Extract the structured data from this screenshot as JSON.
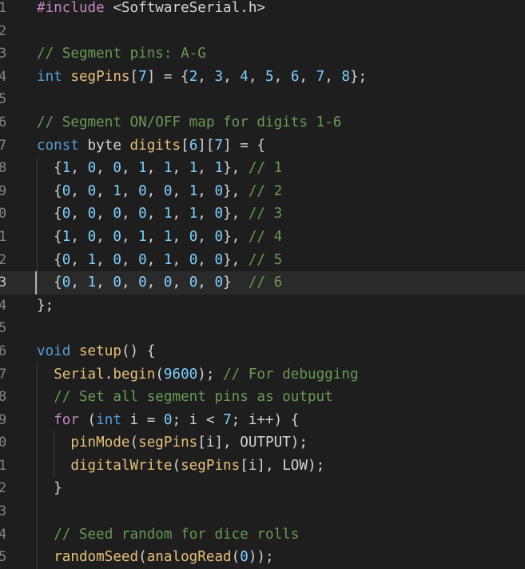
{
  "editor": {
    "language": "Arduino C++",
    "lines": [
      {
        "n": "1",
        "segs": [
          {
            "t": "#include ",
            "c": "c-pre"
          },
          {
            "t": "<SoftwareSerial.h>",
            "c": "c-str"
          }
        ]
      },
      {
        "n": "2",
        "segs": []
      },
      {
        "n": "3",
        "segs": [
          {
            "t": "// Segment pins: A-G",
            "c": "c-comment"
          }
        ]
      },
      {
        "n": "4",
        "segs": [
          {
            "t": "int",
            "c": "c-kw"
          },
          {
            "t": " ",
            "c": "c-id"
          },
          {
            "t": "segPins",
            "c": "c-var"
          },
          {
            "t": "[",
            "c": "c-id"
          },
          {
            "t": "7",
            "c": "c-num"
          },
          {
            "t": "] = {",
            "c": "c-id"
          },
          {
            "t": "2",
            "c": "c-num"
          },
          {
            "t": ", ",
            "c": "c-id"
          },
          {
            "t": "3",
            "c": "c-num"
          },
          {
            "t": ", ",
            "c": "c-id"
          },
          {
            "t": "4",
            "c": "c-num"
          },
          {
            "t": ", ",
            "c": "c-id"
          },
          {
            "t": "5",
            "c": "c-num"
          },
          {
            "t": ", ",
            "c": "c-id"
          },
          {
            "t": "6",
            "c": "c-num"
          },
          {
            "t": ", ",
            "c": "c-id"
          },
          {
            "t": "7",
            "c": "c-num"
          },
          {
            "t": ", ",
            "c": "c-id"
          },
          {
            "t": "8",
            "c": "c-num"
          },
          {
            "t": "};",
            "c": "c-id"
          }
        ]
      },
      {
        "n": "5",
        "segs": []
      },
      {
        "n": "6",
        "segs": [
          {
            "t": "// Segment ON/OFF map for digits 1-6",
            "c": "c-comment"
          }
        ]
      },
      {
        "n": "7",
        "segs": [
          {
            "t": "const",
            "c": "c-kw"
          },
          {
            "t": " byte ",
            "c": "c-id"
          },
          {
            "t": "digits",
            "c": "c-var"
          },
          {
            "t": "[",
            "c": "c-id"
          },
          {
            "t": "6",
            "c": "c-num"
          },
          {
            "t": "][",
            "c": "c-id"
          },
          {
            "t": "7",
            "c": "c-num"
          },
          {
            "t": "] = {",
            "c": "c-id"
          }
        ]
      },
      {
        "n": "8",
        "indent": 1,
        "segs": [
          {
            "t": "  {",
            "c": "c-id"
          },
          {
            "t": "1",
            "c": "c-num"
          },
          {
            "t": ", ",
            "c": "c-id"
          },
          {
            "t": "0",
            "c": "c-num"
          },
          {
            "t": ", ",
            "c": "c-id"
          },
          {
            "t": "0",
            "c": "c-num"
          },
          {
            "t": ", ",
            "c": "c-id"
          },
          {
            "t": "1",
            "c": "c-num"
          },
          {
            "t": ", ",
            "c": "c-id"
          },
          {
            "t": "1",
            "c": "c-num"
          },
          {
            "t": ", ",
            "c": "c-id"
          },
          {
            "t": "1",
            "c": "c-num"
          },
          {
            "t": ", ",
            "c": "c-id"
          },
          {
            "t": "1",
            "c": "c-num"
          },
          {
            "t": "}, ",
            "c": "c-id"
          },
          {
            "t": "// 1",
            "c": "c-comment"
          }
        ]
      },
      {
        "n": "9",
        "indent": 1,
        "segs": [
          {
            "t": "  {",
            "c": "c-id"
          },
          {
            "t": "0",
            "c": "c-num"
          },
          {
            "t": ", ",
            "c": "c-id"
          },
          {
            "t": "0",
            "c": "c-num"
          },
          {
            "t": ", ",
            "c": "c-id"
          },
          {
            "t": "1",
            "c": "c-num"
          },
          {
            "t": ", ",
            "c": "c-id"
          },
          {
            "t": "0",
            "c": "c-num"
          },
          {
            "t": ", ",
            "c": "c-id"
          },
          {
            "t": "0",
            "c": "c-num"
          },
          {
            "t": ", ",
            "c": "c-id"
          },
          {
            "t": "1",
            "c": "c-num"
          },
          {
            "t": ", ",
            "c": "c-id"
          },
          {
            "t": "0",
            "c": "c-num"
          },
          {
            "t": "}, ",
            "c": "c-id"
          },
          {
            "t": "// 2",
            "c": "c-comment"
          }
        ]
      },
      {
        "n": "0",
        "indent": 1,
        "segs": [
          {
            "t": "  {",
            "c": "c-id"
          },
          {
            "t": "0",
            "c": "c-num"
          },
          {
            "t": ", ",
            "c": "c-id"
          },
          {
            "t": "0",
            "c": "c-num"
          },
          {
            "t": ", ",
            "c": "c-id"
          },
          {
            "t": "0",
            "c": "c-num"
          },
          {
            "t": ", ",
            "c": "c-id"
          },
          {
            "t": "0",
            "c": "c-num"
          },
          {
            "t": ", ",
            "c": "c-id"
          },
          {
            "t": "1",
            "c": "c-num"
          },
          {
            "t": ", ",
            "c": "c-id"
          },
          {
            "t": "1",
            "c": "c-num"
          },
          {
            "t": ", ",
            "c": "c-id"
          },
          {
            "t": "0",
            "c": "c-num"
          },
          {
            "t": "}, ",
            "c": "c-id"
          },
          {
            "t": "// 3",
            "c": "c-comment"
          }
        ]
      },
      {
        "n": "1",
        "indent": 1,
        "segs": [
          {
            "t": "  {",
            "c": "c-id"
          },
          {
            "t": "1",
            "c": "c-num"
          },
          {
            "t": ", ",
            "c": "c-id"
          },
          {
            "t": "0",
            "c": "c-num"
          },
          {
            "t": ", ",
            "c": "c-id"
          },
          {
            "t": "0",
            "c": "c-num"
          },
          {
            "t": ", ",
            "c": "c-id"
          },
          {
            "t": "1",
            "c": "c-num"
          },
          {
            "t": ", ",
            "c": "c-id"
          },
          {
            "t": "1",
            "c": "c-num"
          },
          {
            "t": ", ",
            "c": "c-id"
          },
          {
            "t": "0",
            "c": "c-num"
          },
          {
            "t": ", ",
            "c": "c-id"
          },
          {
            "t": "0",
            "c": "c-num"
          },
          {
            "t": "}, ",
            "c": "c-id"
          },
          {
            "t": "// 4",
            "c": "c-comment"
          }
        ]
      },
      {
        "n": "2",
        "indent": 1,
        "segs": [
          {
            "t": "  {",
            "c": "c-id"
          },
          {
            "t": "0",
            "c": "c-num"
          },
          {
            "t": ", ",
            "c": "c-id"
          },
          {
            "t": "1",
            "c": "c-num"
          },
          {
            "t": ", ",
            "c": "c-id"
          },
          {
            "t": "0",
            "c": "c-num"
          },
          {
            "t": ", ",
            "c": "c-id"
          },
          {
            "t": "0",
            "c": "c-num"
          },
          {
            "t": ", ",
            "c": "c-id"
          },
          {
            "t": "1",
            "c": "c-num"
          },
          {
            "t": ", ",
            "c": "c-id"
          },
          {
            "t": "0",
            "c": "c-num"
          },
          {
            "t": ", ",
            "c": "c-id"
          },
          {
            "t": "0",
            "c": "c-num"
          },
          {
            "t": "}, ",
            "c": "c-id"
          },
          {
            "t": "// 5",
            "c": "c-comment"
          }
        ]
      },
      {
        "n": "3",
        "indent": 1,
        "active": true,
        "segs": [
          {
            "t": "  {",
            "c": "c-id"
          },
          {
            "t": "0",
            "c": "c-num"
          },
          {
            "t": ", ",
            "c": "c-id"
          },
          {
            "t": "1",
            "c": "c-num"
          },
          {
            "t": ", ",
            "c": "c-id"
          },
          {
            "t": "0",
            "c": "c-num"
          },
          {
            "t": ", ",
            "c": "c-id"
          },
          {
            "t": "0",
            "c": "c-num"
          },
          {
            "t": ", ",
            "c": "c-id"
          },
          {
            "t": "0",
            "c": "c-num"
          },
          {
            "t": ", ",
            "c": "c-id"
          },
          {
            "t": "0",
            "c": "c-num"
          },
          {
            "t": ", ",
            "c": "c-id"
          },
          {
            "t": "0",
            "c": "c-num"
          },
          {
            "t": "}  ",
            "c": "c-id"
          },
          {
            "t": "// 6",
            "c": "c-comment"
          }
        ]
      },
      {
        "n": "4",
        "segs": [
          {
            "t": "};",
            "c": "c-id"
          }
        ]
      },
      {
        "n": "5",
        "segs": []
      },
      {
        "n": "6",
        "segs": [
          {
            "t": "void",
            "c": "c-kw"
          },
          {
            "t": " ",
            "c": "c-id"
          },
          {
            "t": "setup",
            "c": "c-fn"
          },
          {
            "t": "() {",
            "c": "c-id"
          }
        ]
      },
      {
        "n": "7",
        "indent": 1,
        "segs": [
          {
            "t": "  ",
            "c": "c-id"
          },
          {
            "t": "Serial",
            "c": "c-fn"
          },
          {
            "t": ".",
            "c": "c-id"
          },
          {
            "t": "begin",
            "c": "c-fn"
          },
          {
            "t": "(",
            "c": "c-id"
          },
          {
            "t": "9600",
            "c": "c-num"
          },
          {
            "t": "); ",
            "c": "c-id"
          },
          {
            "t": "// For debugging",
            "c": "c-comment"
          }
        ]
      },
      {
        "n": "8",
        "indent": 1,
        "segs": [
          {
            "t": "  ",
            "c": "c-id"
          },
          {
            "t": "// Set all segment pins as output",
            "c": "c-comment"
          }
        ]
      },
      {
        "n": "9",
        "indent": 1,
        "segs": [
          {
            "t": "  ",
            "c": "c-id"
          },
          {
            "t": "for",
            "c": "c-pre"
          },
          {
            "t": " (",
            "c": "c-id"
          },
          {
            "t": "int",
            "c": "c-kw"
          },
          {
            "t": " i = ",
            "c": "c-id"
          },
          {
            "t": "0",
            "c": "c-num"
          },
          {
            "t": "; i < ",
            "c": "c-id"
          },
          {
            "t": "7",
            "c": "c-num"
          },
          {
            "t": "; i++) {",
            "c": "c-id"
          }
        ]
      },
      {
        "n": "0",
        "indent": 2,
        "segs": [
          {
            "t": "    ",
            "c": "c-id"
          },
          {
            "t": "pinMode",
            "c": "c-fn"
          },
          {
            "t": "(",
            "c": "c-id"
          },
          {
            "t": "segPins",
            "c": "c-var"
          },
          {
            "t": "[i], OUTPUT);",
            "c": "c-id"
          }
        ]
      },
      {
        "n": "1",
        "indent": 2,
        "segs": [
          {
            "t": "    ",
            "c": "c-id"
          },
          {
            "t": "digitalWrite",
            "c": "c-fn"
          },
          {
            "t": "(",
            "c": "c-id"
          },
          {
            "t": "segPins",
            "c": "c-var"
          },
          {
            "t": "[i], LOW);",
            "c": "c-id"
          }
        ]
      },
      {
        "n": "2",
        "indent": 1,
        "segs": [
          {
            "t": "  }",
            "c": "c-id"
          }
        ]
      },
      {
        "n": "3",
        "indent": 1,
        "segs": []
      },
      {
        "n": "4",
        "indent": 1,
        "segs": [
          {
            "t": "  ",
            "c": "c-id"
          },
          {
            "t": "// Seed random for dice rolls",
            "c": "c-comment"
          }
        ]
      },
      {
        "n": "5",
        "indent": 1,
        "segs": [
          {
            "t": "  ",
            "c": "c-id"
          },
          {
            "t": "randomSeed",
            "c": "c-fn"
          },
          {
            "t": "(",
            "c": "c-id"
          },
          {
            "t": "analogRead",
            "c": "c-fn"
          },
          {
            "t": "(",
            "c": "c-id"
          },
          {
            "t": "0",
            "c": "c-num"
          },
          {
            "t": "));",
            "c": "c-id"
          }
        ]
      }
    ]
  }
}
